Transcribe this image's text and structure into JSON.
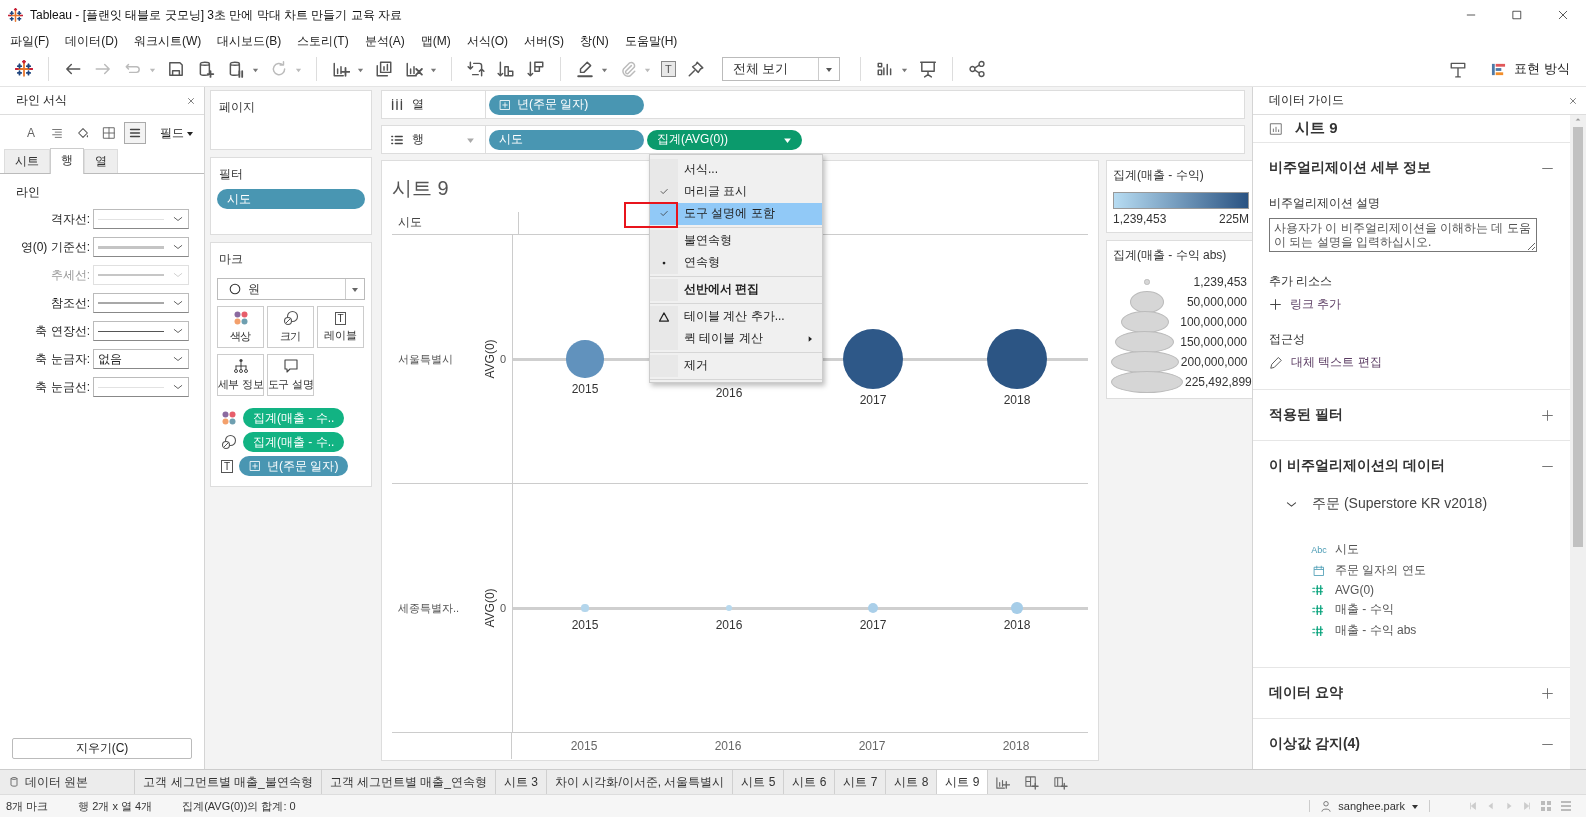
{
  "window": {
    "title": "Tableau - [플랜잇 태블로 굿모닝] 3초 만에 막대 차트 만들기 교육 자료"
  },
  "menu": [
    "파일(F)",
    "데이터(D)",
    "워크시트(W)",
    "대시보드(B)",
    "스토리(T)",
    "분석(A)",
    "맵(M)",
    "서식(O)",
    "서버(S)",
    "창(N)",
    "도움말(H)"
  ],
  "toolbar": {
    "buttons": [
      {
        "kind": "logo"
      },
      {
        "kind": "separator"
      },
      {
        "kind": "undo",
        "disabled": false
      },
      {
        "kind": "redo",
        "disabled": true
      },
      {
        "kind": "replay",
        "disabled": true,
        "caret": true
      },
      {
        "kind": "save",
        "disabled": false
      },
      {
        "kind": "add-datasource",
        "disabled": false
      },
      {
        "kind": "pause",
        "disabled": false,
        "caret": true
      },
      {
        "kind": "refresh",
        "disabled": true,
        "caret": true
      },
      {
        "kind": "separator"
      },
      {
        "kind": "new-sheet",
        "disabled": false,
        "caret": true
      },
      {
        "kind": "duplicate",
        "disabled": false
      },
      {
        "kind": "clear",
        "disabled": false,
        "caret": true
      },
      {
        "kind": "separator"
      },
      {
        "kind": "swap",
        "disabled": false
      },
      {
        "kind": "sort-asc",
        "disabled": false
      },
      {
        "kind": "sort-desc",
        "disabled": false
      },
      {
        "kind": "separator"
      },
      {
        "kind": "highlight",
        "disabled": false,
        "caret": true
      },
      {
        "kind": "annotate",
        "disabled": true,
        "caret": true
      },
      {
        "kind": "labels",
        "selected": true,
        "text": "T"
      },
      {
        "kind": "pin",
        "disabled": false
      },
      {
        "kind": "view-select",
        "label": "전체 보기"
      },
      {
        "kind": "separator"
      },
      {
        "kind": "show-me",
        "disabled": false,
        "caret": true
      },
      {
        "kind": "present",
        "disabled": false
      },
      {
        "kind": "separator"
      },
      {
        "kind": "share",
        "disabled": false
      }
    ],
    "show_me": "표현 방식"
  },
  "format_panel": {
    "title": "라인 서식",
    "tools": [
      {
        "kind": "font",
        "text": "A",
        "selected": false
      },
      {
        "kind": "align",
        "selected": false
      },
      {
        "kind": "shading",
        "selected": false
      },
      {
        "kind": "borders",
        "selected": false
      },
      {
        "kind": "lines",
        "selected": true
      }
    ],
    "field_button": "필드",
    "tabs": [
      {
        "label": "시트",
        "selected": false
      },
      {
        "label": "행",
        "selected": true
      },
      {
        "label": "열",
        "selected": false
      }
    ],
    "section": "라인",
    "rows": [
      {
        "label": "격자선:",
        "kind": "line",
        "disabled": false
      },
      {
        "label": "영(0) 기준선:",
        "kind": "line",
        "disabled": false
      },
      {
        "label": "추세선:",
        "kind": "line",
        "disabled": true
      },
      {
        "label": "참조선:",
        "kind": "line",
        "disabled": false
      },
      {
        "label": "축 연장선:",
        "kind": "line",
        "disabled": false
      },
      {
        "label": "축 눈금자:",
        "kind": "text",
        "value": "없음",
        "disabled": false
      },
      {
        "label": "축 눈금선:",
        "kind": "line",
        "disabled": false
      }
    ],
    "clear_button": "지우기(C)"
  },
  "pages": {
    "title": "페이지"
  },
  "filters": {
    "title": "필터",
    "pills": [
      {
        "label": "시도",
        "measure": false
      }
    ]
  },
  "marks": {
    "title": "마크",
    "mark_type": "원",
    "buttons": [
      {
        "kind": "color",
        "label": "색상"
      },
      {
        "kind": "size",
        "label": "크기"
      },
      {
        "kind": "label",
        "label": "레이블",
        "icon_text": "T"
      },
      {
        "kind": "detail",
        "label": "세부 정보"
      },
      {
        "kind": "tooltip",
        "label": "도구 설명"
      }
    ],
    "fields": [
      {
        "kind": "color",
        "label": "집계(매출 - 수..",
        "measure": true
      },
      {
        "kind": "size",
        "label": "집계(매출 - 수..",
        "measure": true
      },
      {
        "kind": "label",
        "icon_text": "T",
        "label": "년(주문 일자)",
        "measure": false,
        "expand": true
      }
    ]
  },
  "columns_shelf": {
    "label": "열",
    "pills": [
      {
        "label": "년(주문 일자)",
        "measure": false,
        "expand": true
      }
    ]
  },
  "rows_shelf": {
    "label": "행",
    "pills": [
      {
        "label": "시도",
        "measure": false
      },
      {
        "label": "집계(AVG(0))",
        "measure": true,
        "active": true
      }
    ]
  },
  "context_menu": {
    "groups": [
      [
        {
          "label": "서식...",
          "kind": "action",
          "selected": false
        },
        {
          "label": "머리글 표시",
          "kind": "check",
          "checked": true,
          "selected": false
        },
        {
          "label": "도구 설명에 포함",
          "kind": "check",
          "checked": true,
          "selected": true,
          "highlighted": true
        }
      ],
      [
        {
          "label": "불연속형",
          "kind": "radio",
          "checked": false,
          "selected": false
        },
        {
          "label": "연속형",
          "kind": "radio",
          "checked": true,
          "selected": false
        }
      ],
      [
        {
          "label": "선반에서 편집",
          "kind": "action",
          "selected": false,
          "bold": true
        }
      ],
      [
        {
          "label": "테이블 계산 추가...",
          "kind": "calc",
          "selected": false
        },
        {
          "label": "퀵 테이블 계산",
          "kind": "submenu",
          "selected": false
        }
      ],
      [
        {
          "label": "제거",
          "kind": "action",
          "selected": false
        }
      ]
    ]
  },
  "view": {
    "title": "시트 9",
    "row_header": "시도",
    "rows": [
      {
        "label": "서울특별시",
        "axis": "AVG(0)",
        "tick": "0",
        "marks": [
          {
            "year": "2015",
            "color": "#6192bd"
          },
          {
            "year": "2016"
          },
          {
            "year": "2017",
            "color": "#2e5888"
          },
          {
            "year": "2018",
            "color": "#2c5584"
          }
        ]
      },
      {
        "label": "세종특별자..",
        "axis": "AVG(0)",
        "tick": "0",
        "marks": [
          {
            "year": "2015",
            "color": "#b4d6ec"
          },
          {
            "year": "2016",
            "color": "#b8d9ee"
          },
          {
            "year": "2017",
            "color": "#aacfe9"
          },
          {
            "year": "2018",
            "color": "#a6cde8"
          }
        ]
      }
    ],
    "x_axis": [
      "2015",
      "2016",
      "2017",
      "2018"
    ]
  },
  "color_legend": {
    "title": "집계(매출 - 수익)",
    "min": "1,239,453",
    "max": "225M"
  },
  "size_legend": {
    "title": "집계(매출 - 수익 abs)",
    "items": [
      {
        "label": "1,239,453"
      },
      {
        "label": "50,000,000"
      },
      {
        "label": "100,000,000"
      },
      {
        "label": "150,000,000"
      },
      {
        "label": "200,000,000"
      },
      {
        "label": "225,492,899"
      }
    ]
  },
  "data_guide": {
    "title": "데이터 가이드",
    "sheet": "시트 9",
    "details": {
      "title": "비주얼리제이션 세부 정보",
      "expanded": true,
      "description_label": "비주얼리제이션 설명",
      "description_placeholder": "사용자가 이 비주얼리제이션을 이해하는 데 도움이 되는 설명을 입력하십시오.",
      "resources_label": "추가 리소스",
      "add_link": "링크 추가",
      "accessibility_label": "접근성",
      "alt_text_link": "대체 텍스트 편집"
    },
    "filters": {
      "title": "적용된 필터",
      "expanded": false
    },
    "data": {
      "title": "이 비주얼리제이션의 데이터",
      "expanded": true,
      "source": {
        "label": "주문 (Superstore KR v2018)",
        "expanded": true
      },
      "fields": [
        {
          "kind": "string",
          "type_label": "Abc",
          "label": "시도"
        },
        {
          "kind": "date",
          "label": "주문 일자의 연도"
        },
        {
          "kind": "measure",
          "label": "AVG(0)"
        },
        {
          "kind": "measure",
          "label": "매출 - 수익"
        },
        {
          "kind": "measure",
          "label": "매출 - 수익 abs"
        }
      ]
    },
    "summary": {
      "title": "데이터 요약",
      "expanded": false
    },
    "outliers": {
      "title": "이상값 감지(4)",
      "expanded": true
    }
  },
  "sheet_tabs": [
    {
      "label": "데이터 원본",
      "kind": "datasource",
      "selected": false
    },
    {
      "label": "고객 세그먼트별 매출_불연속형",
      "kind": "sheet",
      "selected": false
    },
    {
      "label": "고객 세그먼트별 매출_연속형",
      "kind": "sheet",
      "selected": false
    },
    {
      "label": "시트 3",
      "kind": "sheet",
      "selected": false
    },
    {
      "label": "차이 시각화/이서준, 서울특별시",
      "kind": "sheet",
      "selected": false
    },
    {
      "label": "시트 5",
      "kind": "sheet",
      "selected": false
    },
    {
      "label": "시트 6",
      "kind": "sheet",
      "selected": false
    },
    {
      "label": "시트 7",
      "kind": "sheet",
      "selected": false
    },
    {
      "label": "시트 8",
      "kind": "sheet",
      "selected": false
    },
    {
      "label": "시트 9",
      "kind": "sheet",
      "selected": true
    }
  ],
  "status_bar": {
    "marks": "8개 마크",
    "dimensions": "행 2개 x 열 4개",
    "sum": "집계(AVG(0))의 합계: 0",
    "user": "sanghee.park"
  }
}
